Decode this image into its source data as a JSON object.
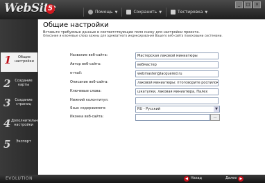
{
  "app": {
    "logo_text": "WebSite",
    "logo_version": "5",
    "footer_brand": "EVOLUTION"
  },
  "toolbar": {
    "help_label": "Помощь",
    "save_label": "Сохранить",
    "test_label": "Тестировка"
  },
  "sidebar": {
    "steps": [
      {
        "num": "1",
        "label": "Общие настройки"
      },
      {
        "num": "2",
        "label": "Создание карты"
      },
      {
        "num": "3",
        "label": "Создание страниц"
      },
      {
        "num": "4",
        "label": "Дополнительные настройки"
      },
      {
        "num": "5",
        "label": "Экспорт"
      }
    ]
  },
  "main": {
    "title": "Общие настройки",
    "desc1": "Вставьте требуемые данные в соответствующие поля снизу для настройки проекта.",
    "desc2": "Описание и ключевые слова важны для адекватного индексирования Вашего веб-сайта поисковыми системами.",
    "fields": [
      {
        "label": "Название веб-сайта:",
        "value": "Мастерская лаковой миниатюры"
      },
      {
        "label": "Автор веб-сайта:",
        "value": "вебмастер"
      },
      {
        "label": "e-mail:",
        "value": "webmaster@lacquered.ru"
      },
      {
        "label": "Описание веб-сайта:",
        "value": "лаковой миниатюры: птоговорите роспилок, сувениров"
      },
      {
        "label": "Ключевые слова:",
        "value": "шкатулки, лаковая миниатюра, Палех"
      },
      {
        "label": "Нижний колонтитул:",
        "value": ""
      },
      {
        "label": "Язык содержимого:",
        "value": "RU - Русский"
      },
      {
        "label": "Иконка веб-сайта:",
        "value": ""
      }
    ],
    "browse_label": "..."
  },
  "footer": {
    "prev_label": "Назад",
    "next_label": "Далее"
  },
  "colors": {
    "accent": "#c0101a",
    "sidebar": "#2f2f2f",
    "field_border": "#8a9bb5"
  }
}
